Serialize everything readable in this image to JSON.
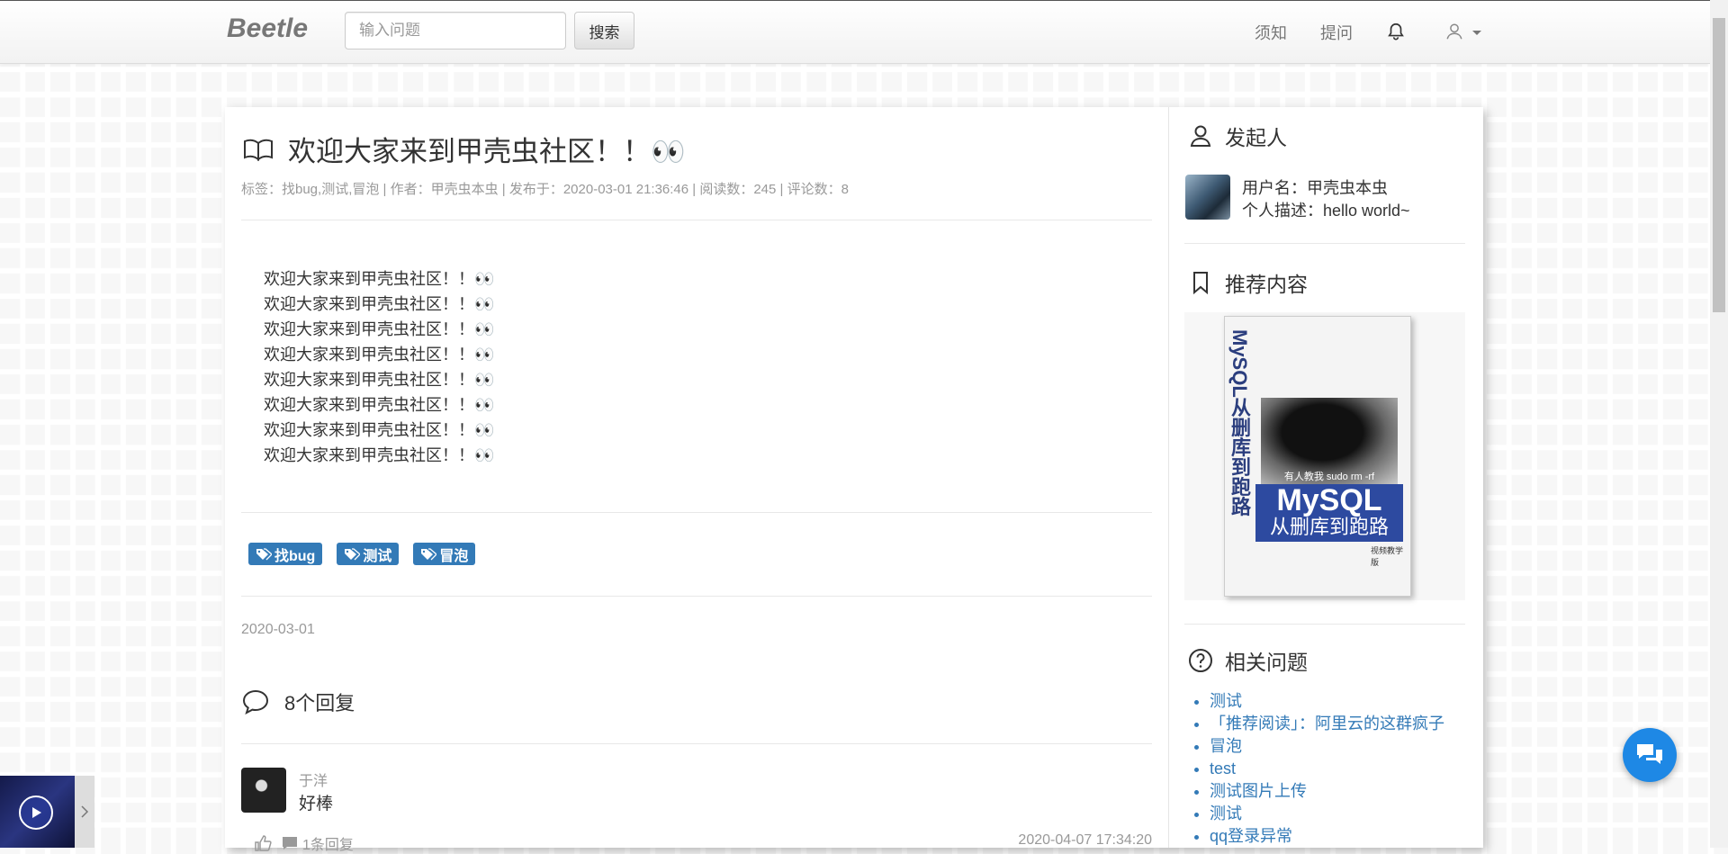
{
  "navbar": {
    "brand": "Beetle",
    "search_placeholder": "输入问题",
    "search_button": "搜索",
    "links": [
      "须知",
      "提问"
    ]
  },
  "post": {
    "title": "欢迎大家来到甲壳虫社区！！👀",
    "meta": "标签：找bug,测试,冒泡 | 作者：甲壳虫本虫 | 发布于：2020-03-01 21:36:46 | 阅读数：245 | 评论数：8",
    "content_lines": [
      "欢迎大家来到甲壳虫社区！！👀",
      "欢迎大家来到甲壳虫社区！！👀",
      "欢迎大家来到甲壳虫社区！！👀",
      "欢迎大家来到甲壳虫社区！！👀",
      "欢迎大家来到甲壳虫社区！！👀",
      "欢迎大家来到甲壳虫社区！！👀",
      "欢迎大家来到甲壳虫社区！！👀",
      "欢迎大家来到甲壳虫社区！！👀"
    ],
    "tags": [
      "找bug",
      "测试",
      "冒泡"
    ],
    "date": "2020-03-01",
    "replies_title": "8个回复"
  },
  "comment": {
    "user": "于洋",
    "text": "好棒",
    "reply_count": "1条回复",
    "time": "2020-04-07 17:34:20"
  },
  "sidebar": {
    "author_title": "发起人",
    "author_name": "用户名：甲壳虫本虫",
    "author_desc": "个人描述：hello world~",
    "recommend_title": "推荐内容",
    "book": {
      "spine": "MySQL从删库到跑路",
      "caption": "有人教我 sudo rm -rf",
      "title_en": "MySQL",
      "title_cn": "从删库到跑路",
      "edition": "视频教学版"
    },
    "related_title": "相关问题",
    "related": [
      "测试",
      "「推荐阅读」：阿里云的这群疯子",
      "冒泡",
      "test",
      "测试图片上传",
      "测试",
      "qq登录异常"
    ]
  },
  "colors": {
    "accent": "#337ab7",
    "fab": "#1e88e5"
  }
}
